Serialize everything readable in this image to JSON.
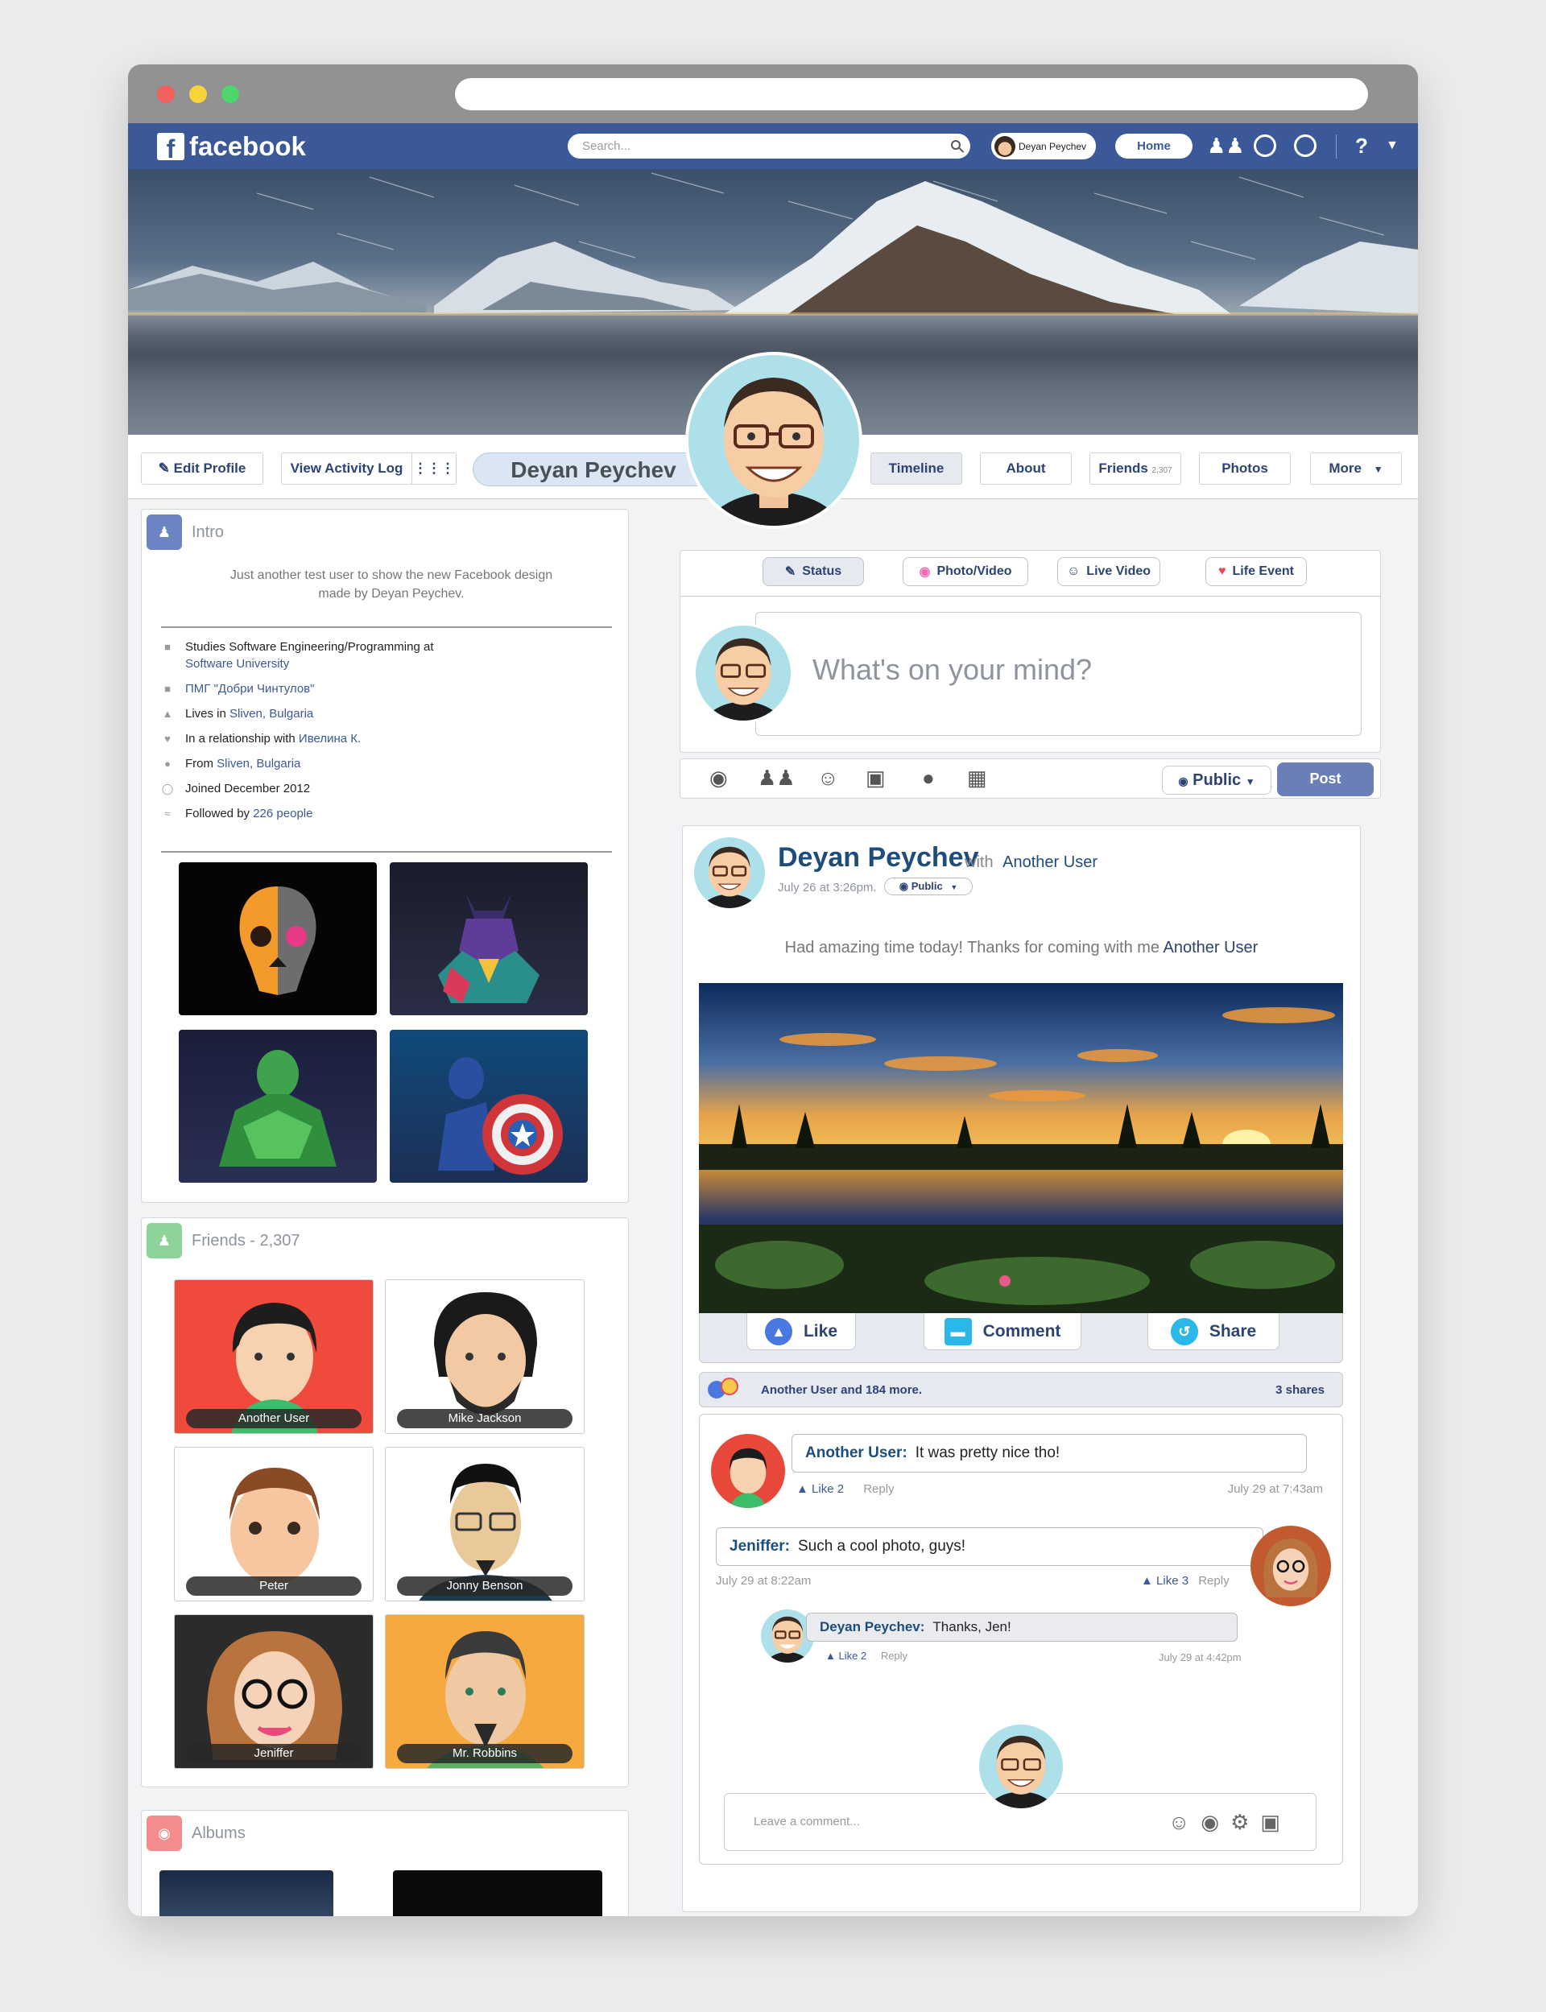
{
  "browser": {
    "url": ""
  },
  "header": {
    "logo_text": "facebook",
    "search_placeholder": "Search...",
    "user_chip": "Deyan Peychev",
    "home_label": "Home",
    "help_label": "?"
  },
  "profile": {
    "name": "Deyan Peychev",
    "edit_profile": "Edit Profile",
    "view_activity_log": "View Activity Log",
    "tabs": [
      {
        "label": "Timeline"
      },
      {
        "label": "About"
      },
      {
        "label": "Friends",
        "count": "2,307"
      },
      {
        "label": "Photos"
      },
      {
        "label": "More"
      }
    ]
  },
  "intro": {
    "title": "Intro",
    "bio_line1": "Just another test user to show the new Facebook design",
    "bio_line2": "made by Deyan Peychev.",
    "facts": [
      {
        "pre": "Studies Software Engineering/Programming at",
        "link": "Software University",
        "post": ""
      },
      {
        "pre": "",
        "link": "ПМГ \"Добри Чинтулов\"",
        "post": ""
      },
      {
        "pre": "Lives in ",
        "link": "Sliven, Bulgaria",
        "post": ""
      },
      {
        "pre": "In a relationship with ",
        "link": "Ивелина К.",
        "post": ""
      },
      {
        "pre": "From ",
        "link": "Sliven, Bulgaria",
        "post": ""
      },
      {
        "pre": "Joined December 2012",
        "link": "",
        "post": ""
      },
      {
        "pre": "Followed by ",
        "link": "226 people",
        "post": ""
      }
    ]
  },
  "friends": {
    "title": "Friends - 2,307",
    "list": [
      {
        "name": "Another User"
      },
      {
        "name": "Mike Jackson"
      },
      {
        "name": "Peter"
      },
      {
        "name": "Jonny Benson"
      },
      {
        "name": "Jeniffer"
      },
      {
        "name": "Mr. Robbins"
      }
    ]
  },
  "albums": {
    "title": "Albums"
  },
  "composer": {
    "status": "Status",
    "photo_video": "Photo/Video",
    "live_video": "Live Video",
    "life_event": "Life Event",
    "placeholder": "What's on your mind?",
    "privacy": "Public",
    "post": "Post"
  },
  "post": {
    "author": "Deyan Peychev",
    "with_word": "with",
    "with_user": "Another User",
    "date": "July 26 at 3:26pm.",
    "privacy": "Public",
    "text": "Had amazing time today! Thanks for coming with me ",
    "text_link": "Another User",
    "like": "Like",
    "comment": "Comment",
    "share": "Share",
    "reactions": "Another User and 184 more.",
    "shares": "3 shares",
    "comments": [
      {
        "author": "Another User:",
        "text": "It was pretty nice tho!",
        "likes": "Like 2",
        "reply": "Reply",
        "date": "July 29 at 7:43am"
      },
      {
        "author": "Jeniffer:",
        "text": "Such a cool photo, guys!",
        "likes": "Like 3",
        "reply": "Reply",
        "date": "July 29 at 8:22am"
      },
      {
        "author": "Deyan Peychev:",
        "text": "Thanks, Jen!",
        "likes": "Like 2",
        "reply": "Reply",
        "date": "July 29 at 4:42pm"
      }
    ],
    "leave_comment": "Leave a comment..."
  }
}
